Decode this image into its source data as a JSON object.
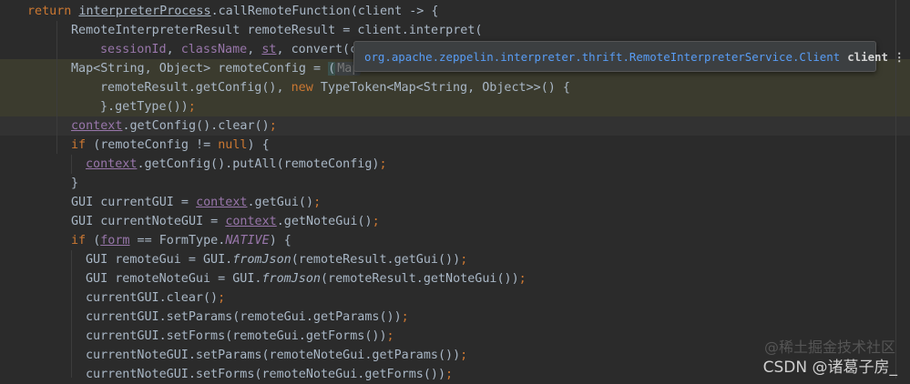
{
  "editor": {
    "lines": [
      {
        "parts": [
          [
            "kw",
            "return "
          ],
          [
            "u",
            "interpreterProcess"
          ],
          [
            "",
            "."
          ],
          [
            "",
            "callRemoteFunction(client -> {"
          ]
        ]
      },
      {
        "parts": [
          [
            "",
            "RemoteInterpreterResult remoteResult = client.interpret("
          ]
        ]
      },
      {
        "parts": [
          [
            "fld",
            "sessionId"
          ],
          [
            "",
            ", "
          ],
          [
            "fld",
            "className"
          ],
          [
            "",
            ", "
          ],
          [
            "fldu",
            "st"
          ],
          [
            "",
            ", convert(c"
          ]
        ]
      },
      {
        "parts": [
          [
            "",
            "Map<String, Object> remoteConfig = "
          ],
          [
            "match",
            "("
          ],
          [
            "inlay",
            "Map"
          ]
        ]
      },
      {
        "parts": [
          [
            "",
            "remoteResult.getConfig(), "
          ],
          [
            "kw",
            "new "
          ],
          [
            "",
            "TypeToken<Map<String, Object>>() {"
          ]
        ]
      },
      {
        "parts": [
          [
            "",
            "}.getType())"
          ],
          [
            "kw",
            ";"
          ]
        ]
      },
      {
        "parts": [
          [
            "fldu",
            "context"
          ],
          [
            "",
            ".getConfig().clear()"
          ],
          [
            "kw",
            ";"
          ]
        ]
      },
      {
        "parts": [
          [
            "kw",
            "if "
          ],
          [
            "",
            "(remoteConfig != "
          ],
          [
            "kw",
            "null"
          ],
          [
            "",
            ") {"
          ]
        ]
      },
      {
        "parts": [
          [
            "fldu",
            "context"
          ],
          [
            "",
            ".getConfig().putAll(remoteConfig)"
          ],
          [
            "kw",
            ";"
          ]
        ]
      },
      {
        "parts": [
          [
            "",
            "}"
          ]
        ]
      },
      {
        "parts": [
          [
            "",
            "GUI currentGUI = "
          ],
          [
            "fldu",
            "context"
          ],
          [
            "",
            ".getGui()"
          ],
          [
            "kw",
            ";"
          ]
        ]
      },
      {
        "parts": [
          [
            "",
            "GUI currentNoteGUI = "
          ],
          [
            "fldu",
            "context"
          ],
          [
            "",
            ".getNoteGui()"
          ],
          [
            "kw",
            ";"
          ]
        ]
      },
      {
        "parts": [
          [
            "kw",
            "if "
          ],
          [
            "",
            "("
          ],
          [
            "fldu",
            "form"
          ],
          [
            "",
            " == FormType."
          ],
          [
            "fldi",
            "NATIVE"
          ],
          [
            "",
            ") {"
          ]
        ]
      },
      {
        "parts": [
          [
            "",
            "GUI remoteGui = GUI."
          ],
          [
            "it",
            "fromJson"
          ],
          [
            "",
            "(remoteResult.getGui())"
          ],
          [
            "kw",
            ";"
          ]
        ]
      },
      {
        "parts": [
          [
            "",
            "GUI remoteNoteGui = GUI."
          ],
          [
            "it",
            "fromJson"
          ],
          [
            "",
            "(remoteResult.getNoteGui())"
          ],
          [
            "kw",
            ";"
          ]
        ]
      },
      {
        "parts": [
          [
            "",
            "currentGUI.clear()"
          ],
          [
            "kw",
            ";"
          ]
        ]
      },
      {
        "parts": [
          [
            "",
            "currentGUI.setParams(remoteGui.getParams())"
          ],
          [
            "kw",
            ";"
          ]
        ]
      },
      {
        "parts": [
          [
            "",
            "currentGUI.setForms(remoteGui.getForms())"
          ],
          [
            "kw",
            ";"
          ]
        ]
      },
      {
        "parts": [
          [
            "",
            "currentNoteGUI.setParams(remoteNoteGui.getParams())"
          ],
          [
            "kw",
            ";"
          ]
        ]
      },
      {
        "parts": [
          [
            "",
            "currentNoteGUI.setForms(remoteNoteGui.getForms())"
          ],
          [
            "kw",
            ";"
          ]
        ]
      }
    ]
  },
  "hint": {
    "class_name": "org.apache.zeppelin.interpreter.thrift.RemoteInterpreterService.Client",
    "variable": "client",
    "more": "⋮"
  },
  "watermark": {
    "text": "CSDN @诸葛子房_",
    "background_text": "@稀土掘金技术社区"
  },
  "colors": {
    "background": "#2b2b2b",
    "keyword": "#cc7832",
    "field": "#9876aa",
    "text": "#a9b7c6",
    "hint_link": "#589df6"
  }
}
